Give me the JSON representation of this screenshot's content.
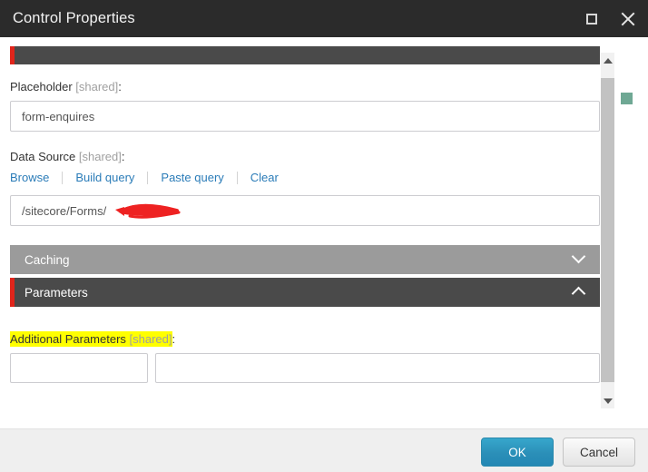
{
  "window": {
    "title": "Control Properties",
    "maximize_icon": "maximize-icon",
    "close_icon": "close-icon"
  },
  "form": {
    "placeholder_field": {
      "label": "Placeholder",
      "shared_tag": "[shared]",
      "colon": ":",
      "value": "form-enquires",
      "placeholder": ""
    },
    "data_source_field": {
      "label": "Data Source",
      "shared_tag": "[shared]",
      "colon": ":",
      "value": "/sitecore/Forms/",
      "placeholder": "",
      "links": [
        {
          "label": "Browse"
        },
        {
          "label": "Build query"
        },
        {
          "label": "Paste query"
        },
        {
          "label": "Clear"
        }
      ],
      "redacted": true
    },
    "sections": [
      {
        "label": "Caching",
        "expanded": false,
        "chevron": "chevron-down-icon"
      },
      {
        "label": "Parameters",
        "expanded": true,
        "chevron": "chevron-up-icon"
      }
    ],
    "additional_parameters": {
      "label_highlighted": "Additional Parameters ",
      "shared_tag": "[shared]",
      "colon": ":",
      "name_value": "",
      "name_placeholder": "",
      "value_value": "",
      "value_placeholder": ""
    }
  },
  "scrollbar": {
    "up_arrow": "scroll-up-arrow-icon",
    "down_arrow": "scroll-down-arrow-icon"
  },
  "footer": {
    "ok_label": "OK",
    "cancel_label": "Cancel"
  },
  "colors": {
    "titlebar": "#2b2b2b",
    "accent_red": "#e1251b",
    "section_dark": "#4a4a4a",
    "section_light": "#9b9b9b",
    "link_blue": "#2b7cb8",
    "ok_blue": "#2b8fb8",
    "highlight_yellow": "#ffff00",
    "redaction_red": "#ee2222",
    "marker_green": "#6fa894"
  }
}
